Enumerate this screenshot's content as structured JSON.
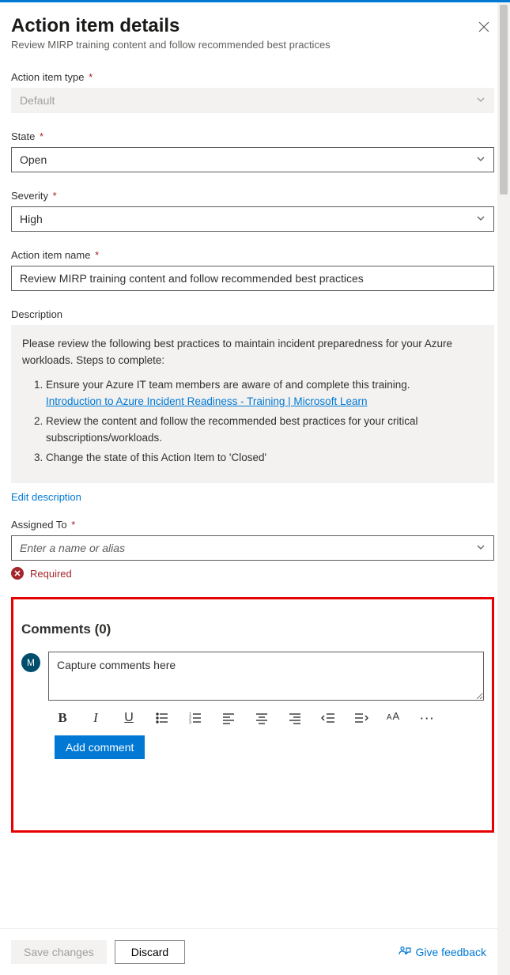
{
  "header": {
    "title": "Action item details",
    "subtitle": "Review MIRP training content and follow recommended best practices"
  },
  "fields": {
    "type_label": "Action item type",
    "type_value": "Default",
    "state_label": "State",
    "state_value": "Open",
    "severity_label": "Severity",
    "severity_value": "High",
    "name_label": "Action item name",
    "name_value": "Review MIRP training content and follow recommended best practices",
    "desc_label": "Description",
    "desc_lead": "Please review the following best practices to maintain incident preparedness for your Azure workloads. Steps to complete:",
    "desc_steps": [
      "Ensure your Azure IT team members are aware of and complete this training.",
      "Review the content and follow the recommended best practices for your critical subscriptions/workloads.",
      "Change the state of this Action Item to 'Closed'"
    ],
    "desc_link": "Introduction to Azure Incident Readiness - Training | Microsoft Learn",
    "edit_desc": "Edit description",
    "assigned_label": "Assigned To",
    "assigned_placeholder": "Enter a name or alias",
    "required_error": "Required"
  },
  "comments": {
    "heading": "Comments (0)",
    "avatar_initial": "M",
    "placeholder": "Capture comments here",
    "add_btn": "Add comment"
  },
  "footer": {
    "save": "Save changes",
    "discard": "Discard",
    "feedback": "Give feedback"
  },
  "req_mark": "*"
}
